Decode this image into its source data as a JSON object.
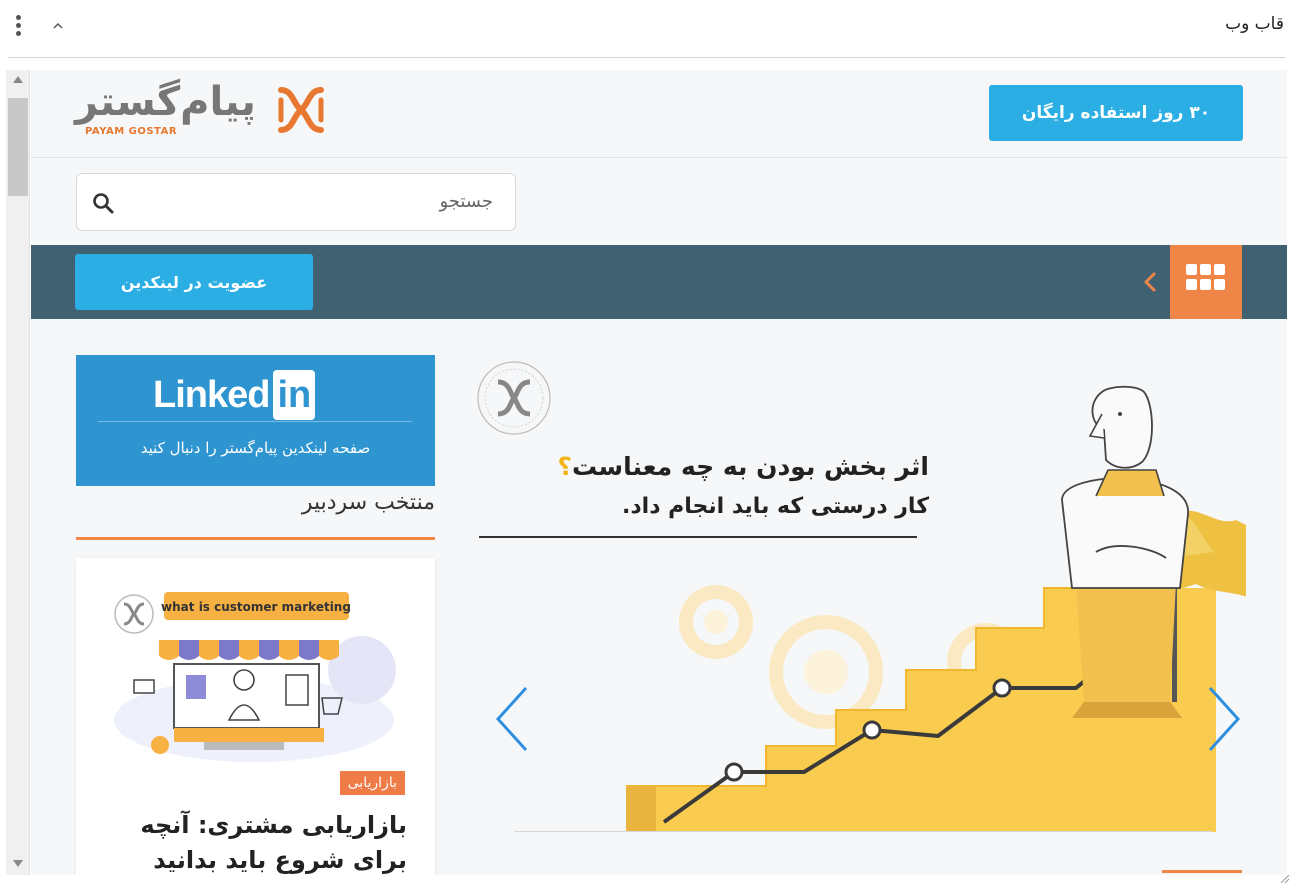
{
  "panel": {
    "title": "قاب وب"
  },
  "header": {
    "logo_fa": "پیام‌گستر",
    "logo_en": "PAYAM GOSTAR",
    "cta_label": "۳۰ روز استفاده رایگان"
  },
  "search": {
    "placeholder": "جستجو"
  },
  "nav": {
    "linkedin_join_label": "عضویت در لینکدین"
  },
  "linkedin_card": {
    "word": "Linked",
    "box": "in",
    "subtitle": "صفحه لینکدین پیام‌گستر را دنبال کنید"
  },
  "editors_pick": {
    "title": "منتخب سردبیر",
    "post": {
      "image_caption": "what is customer marketing",
      "tag": "بازاریابی",
      "title": "بازاریابی مشتری: آنچه برای شروع باید بدانید"
    }
  },
  "slider": {
    "title": "اثر بخش بودن به چه معناست",
    "title_mark": "؟",
    "subtitle": "کار درستی که باید انجام داد."
  },
  "colors": {
    "accent_blue": "#2aaee3",
    "accent_orange": "#ef8547",
    "nav_bg": "#406171",
    "linkedin_bg": "#2e95d1"
  }
}
